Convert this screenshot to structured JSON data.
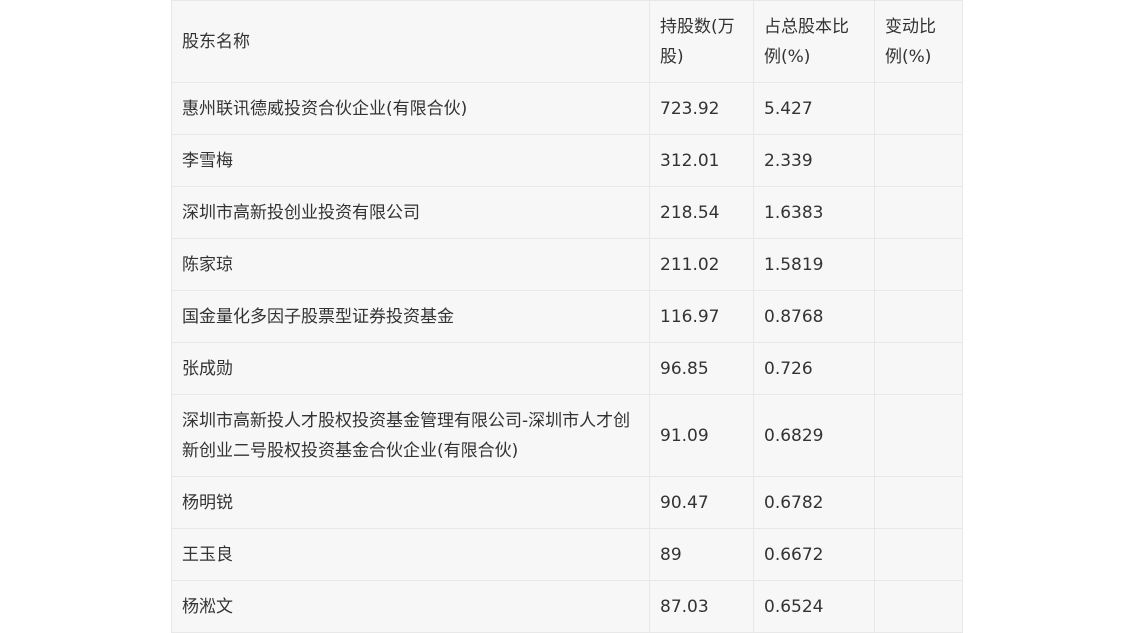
{
  "table": {
    "headers": [
      "股东名称",
      "持股数(万股)",
      "占总股本比例(%)",
      "变动比例(%)"
    ],
    "rows": [
      [
        "惠州联讯德威投资合伙企业(有限合伙)",
        "723.92",
        "5.427",
        ""
      ],
      [
        "李雪梅",
        "312.01",
        "2.339",
        ""
      ],
      [
        "深圳市高新投创业投资有限公司",
        "218.54",
        "1.6383",
        ""
      ],
      [
        "陈家琼",
        "211.02",
        "1.5819",
        ""
      ],
      [
        "国金量化多因子股票型证券投资基金",
        "116.97",
        "0.8768",
        ""
      ],
      [
        "张成勋",
        "96.85",
        "0.726",
        ""
      ],
      [
        "深圳市高新投人才股权投资基金管理有限公司-深圳市人才创新创业二号股权投资基金合伙企业(有限合伙)",
        "91.09",
        "0.6829",
        ""
      ],
      [
        "杨明锐",
        "90.47",
        "0.6782",
        ""
      ],
      [
        "王玉良",
        "89",
        "0.6672",
        ""
      ],
      [
        "杨淞文",
        "87.03",
        "0.6524",
        ""
      ]
    ]
  }
}
